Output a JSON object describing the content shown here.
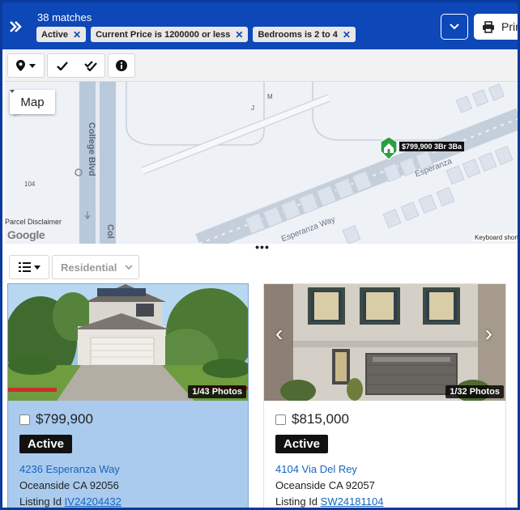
{
  "header": {
    "match_count": "38 matches",
    "print_label": "Print",
    "filters": [
      {
        "label": "Active"
      },
      {
        "label": "Current Price is 1200000 or less"
      },
      {
        "label": "Bedrooms is 2 to 4"
      }
    ]
  },
  "map": {
    "type_button": "Map",
    "parcel_disclaimer": "Parcel Disclaimer",
    "google_logo": "Google",
    "keyboard_shortcuts": "Keyboard short",
    "marker_label": "$799,900 3Br 3Ba",
    "streets": {
      "college_blvd": "College Blvd",
      "college_blvd_2": "Col",
      "esperanza_way": "Esperanza Way",
      "esperanza_way_2": "Esperanza",
      "num_104": "104",
      "letter_m": "M",
      "letter_j": "J"
    }
  },
  "results_toolbar": {
    "property_type": "Residential"
  },
  "listings": [
    {
      "photo_count": "1/43 Photos",
      "price": "$799,900",
      "status": "Active",
      "address": "4236 Esperanza Way",
      "city": "Oceanside CA 92056",
      "listing_id_label": "Listing Id",
      "listing_id": "IV24204432"
    },
    {
      "photo_count": "1/32 Photos",
      "price": "$815,000",
      "status": "Active",
      "address": "4104 Via Del Rey",
      "city": "Oceanside CA 92057",
      "listing_id_label": "Listing Id",
      "listing_id": "SW24181104"
    }
  ],
  "colors": {
    "header_bg": "#0d47b8",
    "selected_card_bg": "#aacbee",
    "link": "#1565c0",
    "marker": "#2e9e44"
  }
}
